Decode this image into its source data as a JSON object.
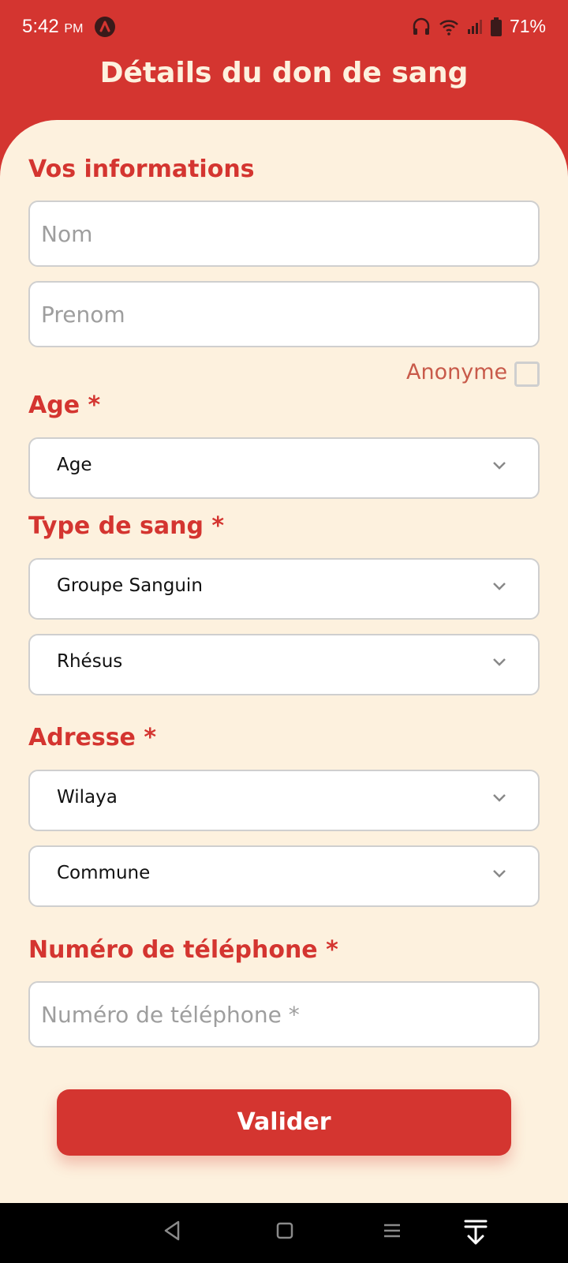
{
  "status_bar": {
    "time": "5:42",
    "meridiem": "PM",
    "battery": "71%",
    "icons": [
      "app-notification-icon",
      "headphones-icon",
      "wifi-icon",
      "signal-icon",
      "battery-icon"
    ]
  },
  "header": {
    "title": "Détails du don de sang"
  },
  "form": {
    "personal_section_title": "Vos informations",
    "nom_placeholder": "Nom",
    "prenom_placeholder": "Prenom",
    "anonyme_label": "Anonyme",
    "anonyme_checked": false,
    "age_section_title": "Age *",
    "age_select_value": "Age",
    "blood_section_title": "Type de sang *",
    "groupe_select_value": "Groupe Sanguin",
    "rhesus_select_value": "Rhésus",
    "address_section_title": "Adresse *",
    "wilaya_select_value": "Wilaya",
    "commune_select_value": "Commune",
    "phone_section_title": "Numéro de téléphone *",
    "phone_placeholder": "Numéro de téléphone *",
    "submit_label": "Valider"
  },
  "nav_bar": {
    "icons": [
      "back-icon",
      "home-icon",
      "menu-icon",
      "download-icon"
    ]
  },
  "colors": {
    "primary_red": "#d43530",
    "background_cream": "#fdf1de",
    "input_border": "#cfcfcf",
    "placeholder_gray": "#9e9e9e",
    "anonyme_text": "#c85a4a"
  }
}
